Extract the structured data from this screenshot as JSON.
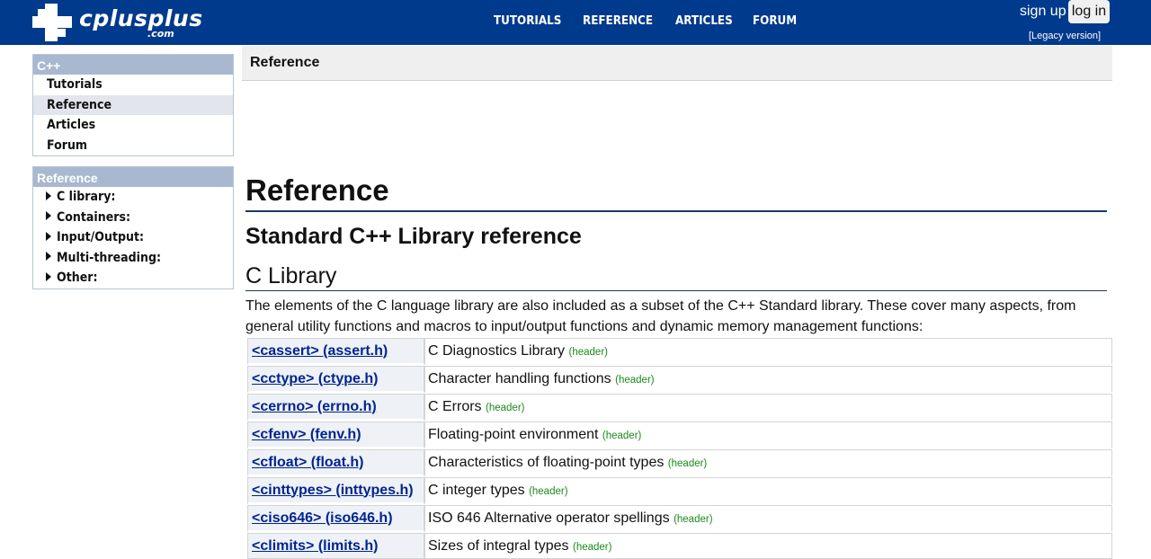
{
  "topbar": {
    "logo_word": "cplusplus",
    "logo_com": ".com",
    "nav": [
      "TUTORIALS",
      "REFERENCE",
      "ARTICLES",
      "FORUM"
    ],
    "sign_up": "sign up",
    "log_in": "log in",
    "legacy": "[Legacy version]"
  },
  "sidebar": {
    "box1": {
      "title": "C++",
      "items": [
        "Tutorials",
        "Reference",
        "Articles",
        "Forum"
      ],
      "active": "Reference"
    },
    "box2": {
      "title": "Reference",
      "items": [
        "C library:",
        "Containers:",
        "Input/Output:",
        "Multi-threading:",
        "Other:"
      ]
    }
  },
  "breadcrumb": "Reference",
  "main": {
    "h1": "Reference",
    "h2": "Standard C++ Library reference",
    "h3": "C Library",
    "intro": "The elements of the C language library are also included as a subset of the C++ Standard library. These cover many aspects, from general utility functions and macros to input/output functions and dynamic memory management functions:",
    "tag": "(header)",
    "rows": [
      {
        "name": "<cassert> (assert.h)",
        "desc": "C Diagnostics Library"
      },
      {
        "name": "<cctype> (ctype.h)",
        "desc": "Character handling functions"
      },
      {
        "name": "<cerrno> (errno.h)",
        "desc": "C Errors"
      },
      {
        "name": "<cfenv> (fenv.h)",
        "desc": "Floating-point environment"
      },
      {
        "name": "<cfloat> (float.h)",
        "desc": "Characteristics of floating-point types"
      },
      {
        "name": "<cinttypes> (inttypes.h)",
        "desc": "C integer types"
      },
      {
        "name": "<ciso646> (iso646.h)",
        "desc": "ISO 646 Alternative operator spellings"
      },
      {
        "name": "<climits> (limits.h)",
        "desc": "Sizes of integral types"
      }
    ]
  },
  "colors": {
    "topbar": "#003a8c",
    "link": "#00248f",
    "header_tag": "#1a8a1a",
    "sidebar_head": "#a8b8d0"
  }
}
